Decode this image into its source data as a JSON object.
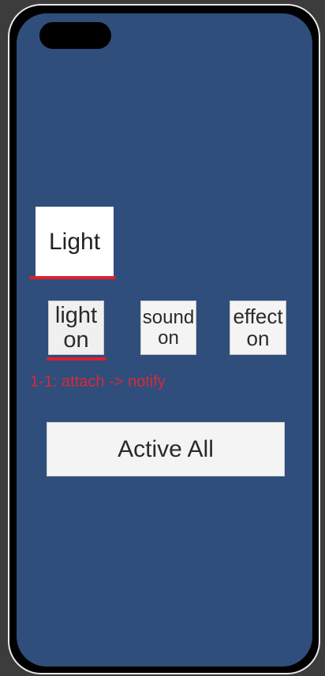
{
  "indicator": {
    "label": "Light"
  },
  "buttons": {
    "light": "light\non",
    "sound": "sound\non",
    "effect": "effect\non",
    "active_all": "Active All"
  },
  "annotation": "1-1: attach -> notify",
  "colors": {
    "screen_bg": "#2f4e7b",
    "underline": "#e0202a",
    "annotation": "#d8283c"
  }
}
